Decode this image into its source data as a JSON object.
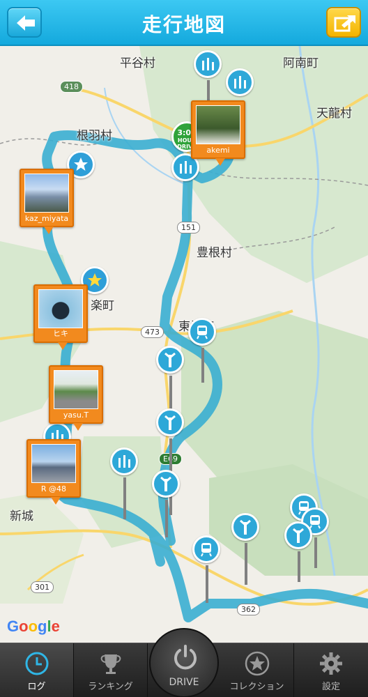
{
  "header": {
    "title": "走行地図",
    "back_icon": "back-arrow-icon",
    "share_icon": "share-icon"
  },
  "map": {
    "places": [
      "平谷村",
      "阿南町",
      "天龍村",
      "根羽村",
      "豊根村",
      "東栄町",
      "新城"
    ],
    "town_fragment": "楽町",
    "roads": [
      "418",
      "151",
      "473",
      "E69",
      "301",
      "362"
    ],
    "attribution": "Google",
    "badge": {
      "line1": "3:00",
      "line2": "HOUR",
      "line3": "DRIVE"
    },
    "photos": [
      {
        "name": "kaz_miyata"
      },
      {
        "name": "akemi"
      },
      {
        "name": "ヒキ"
      },
      {
        "name": "yasu.T"
      },
      {
        "name": "R @48"
      }
    ]
  },
  "nav": {
    "items": [
      {
        "label": "ログ",
        "icon": "clock-icon"
      },
      {
        "label": "ランキング",
        "icon": "trophy-icon"
      },
      {
        "label": "DRIVE",
        "icon": "power-icon"
      },
      {
        "label": "コレクション",
        "icon": "star-icon"
      },
      {
        "label": "設定",
        "icon": "gear-icon"
      }
    ],
    "active": "ログ"
  },
  "colors": {
    "header": "#1fb3e6",
    "route": "#36b2d6",
    "photo_frame": "#f28a1e",
    "nav_bg": "#2a2a2a"
  }
}
